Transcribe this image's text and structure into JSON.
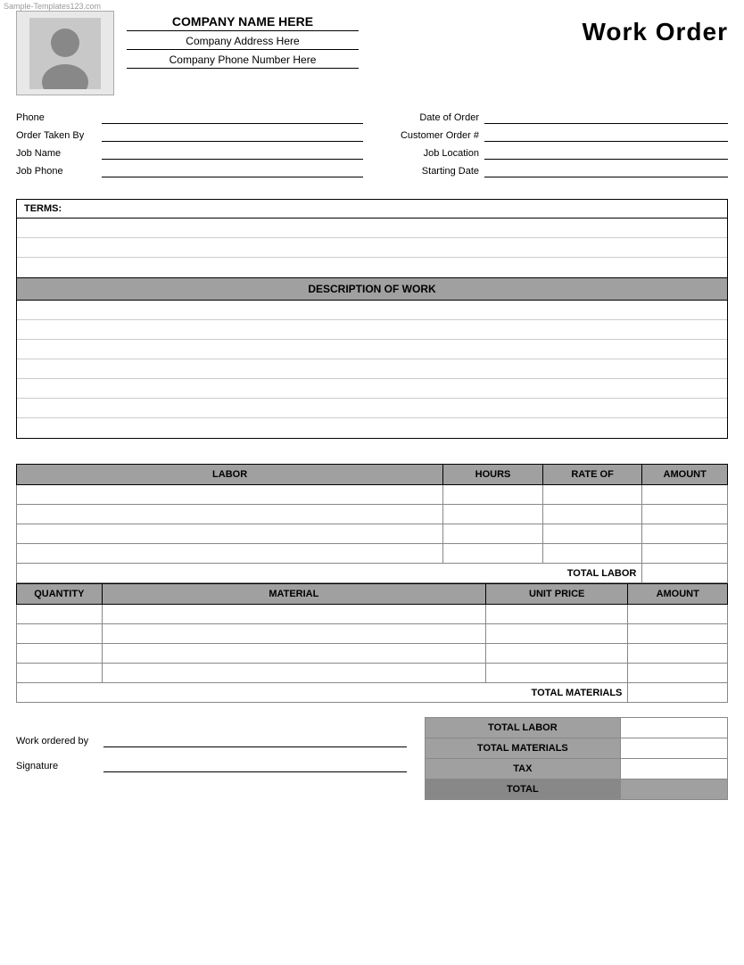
{
  "watermark": "Sample-Templates123.com",
  "header": {
    "company_name": "COMPANY NAME HERE",
    "company_address": "Company Address Here",
    "company_phone": "Company Phone Number Here",
    "title": "Work Order"
  },
  "form": {
    "left": [
      {
        "label": "Phone",
        "value": ""
      },
      {
        "label": "Order Taken By",
        "value": ""
      },
      {
        "label": "Job Name",
        "value": ""
      },
      {
        "label": "Job Phone",
        "value": ""
      }
    ],
    "right": [
      {
        "label": "Date of Order",
        "value": ""
      },
      {
        "label": "Customer Order #",
        "value": ""
      },
      {
        "label": "Job Location",
        "value": ""
      },
      {
        "label": "Starting Date",
        "value": ""
      }
    ]
  },
  "terms": {
    "header": "TERMS:",
    "rows": 3
  },
  "description": {
    "header": "DESCRIPTION OF WORK",
    "rows": 7
  },
  "labor": {
    "columns": [
      "LABOR",
      "HOURS",
      "RATE OF",
      "AMOUNT"
    ],
    "col_widths": [
      "60%",
      "14%",
      "14%",
      "12%"
    ],
    "rows": 4,
    "total_label": "TOTAL LABOR"
  },
  "materials": {
    "columns": [
      "QUANTITY",
      "MATERIAL",
      "UNIT PRICE",
      "AMOUNT"
    ],
    "col_widths": [
      "12%",
      "54%",
      "20%",
      "14%"
    ],
    "rows": 4,
    "total_label": "TOTAL MATERIALS"
  },
  "summary": {
    "work_ordered_by_label": "Work ordered by",
    "signature_label": "Signature",
    "rows": [
      {
        "label": "TOTAL LABOR",
        "value": ""
      },
      {
        "label": "TOTAL MATERIALS",
        "value": ""
      },
      {
        "label": "TAX",
        "value": ""
      },
      {
        "label": "TOTAL",
        "value": "",
        "is_total": true
      }
    ]
  }
}
